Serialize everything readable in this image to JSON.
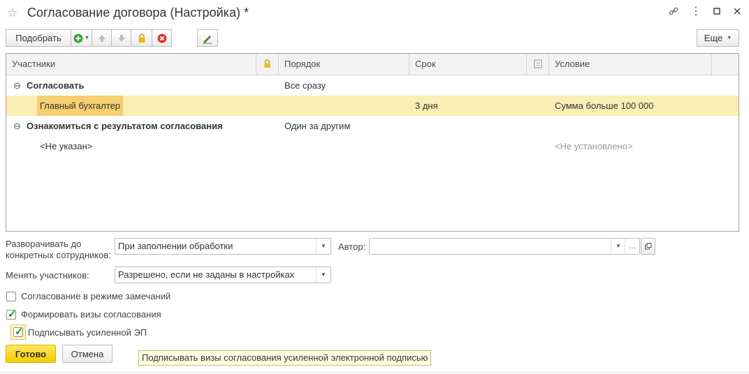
{
  "window": {
    "title": "Согласование договора (Настройка) *"
  },
  "toolbar": {
    "pick_label": "Подобрать",
    "more_label": "Еще"
  },
  "table": {
    "headers": {
      "participants": "Участники",
      "order": "Порядок",
      "deadline": "Срок",
      "condition": "Условие"
    },
    "rows": [
      {
        "participant": "Согласовать",
        "order": "Все сразу",
        "deadline": "",
        "condition": ""
      },
      {
        "participant": "Главный бухгалтер",
        "order": "",
        "deadline": "3 дня",
        "condition": "Сумма больше 100 000"
      },
      {
        "participant": "Ознакомиться с результатом согласования",
        "order": "Один за другим",
        "deadline": "",
        "condition": ""
      },
      {
        "participant": "<Не указан>",
        "order": "",
        "deadline": "",
        "condition": "<Не установлено>"
      }
    ]
  },
  "form": {
    "expand_label_line1": "Разворачивать до",
    "expand_label_line2": "конкретных сотрудников:",
    "expand_value": "При заполнении обработки",
    "author_label": "Автор:",
    "author_value": "",
    "change_label": "Менять участников:",
    "change_value": "Разрешено, если не заданы в настройках",
    "cb_remarks": {
      "label": "Согласование в режиме замечаний",
      "checked": false
    },
    "cb_visas": {
      "label": "Формировать визы согласования",
      "checked": true
    },
    "cb_sign": {
      "label": "Подписывать усиленной ЭП",
      "checked": true
    }
  },
  "footer": {
    "ok_label": "Готово",
    "cancel_label": "Отмена"
  },
  "tooltip": {
    "text": "Подписывать визы согласования усиленной электронной подписью"
  }
}
